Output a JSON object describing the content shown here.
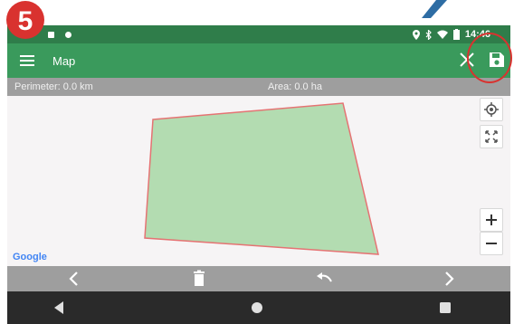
{
  "step": {
    "number": "5",
    "color": "#d9322f"
  },
  "status_bar": {
    "time": "14:46",
    "icons": [
      "lock-icon",
      "square-icon",
      "location-icon",
      "bluetooth-icon",
      "wifi-icon",
      "battery-icon"
    ]
  },
  "app_bar": {
    "title": "Map",
    "menu_icon": "hamburger-menu-icon",
    "close_icon": "close-icon",
    "save_icon": "save-floppy-icon"
  },
  "info_bar": {
    "perimeter": "Perimeter: 0.0 km",
    "area": "Area: 0.0 ha"
  },
  "map": {
    "attribution": "Google",
    "polygon": {
      "fill": "#b3dcb1",
      "stroke": "#e57373"
    },
    "controls": [
      "locate-icon",
      "expand-icon",
      "zoom-in-icon",
      "zoom-out-icon"
    ]
  },
  "toolbar": {
    "buttons": [
      "previous-icon",
      "delete-icon",
      "undo-icon",
      "next-icon"
    ]
  },
  "nav_bar": {
    "buttons": [
      "back-icon",
      "home-icon",
      "recents-icon"
    ]
  },
  "colors": {
    "status_bar": "#2f7d4a",
    "app_bar": "#3a9a5c",
    "info_bar": "#9e9e9e",
    "map_bg": "#f6f4f5",
    "nav_bar": "#2a2a2a",
    "annotation": "#d9322f",
    "pointer": "#2e6da4"
  }
}
